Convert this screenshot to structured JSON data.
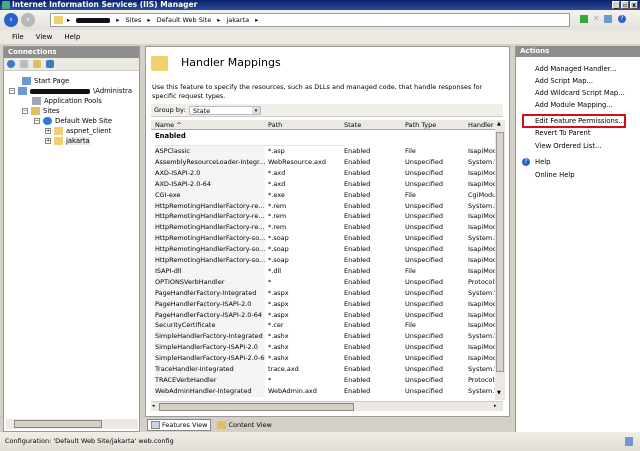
{
  "window": {
    "title": "Internet Information Services (IIS) Manager"
  },
  "address": {
    "crumbs": [
      "Sites",
      "Default Web Site",
      "jakarta"
    ]
  },
  "menu": [
    "File",
    "View",
    "Help"
  ],
  "connections": {
    "title": "Connections",
    "tree": [
      {
        "label": "Start Page"
      },
      {
        "label": "\\Administra"
      },
      {
        "label": "Application Pools"
      },
      {
        "label": "Sites"
      },
      {
        "label": "Default Web Site"
      },
      {
        "label": "aspnet_client"
      },
      {
        "label": "jakarta"
      }
    ]
  },
  "page": {
    "title": "Handler Mappings",
    "description": "Use this feature to specify the resources, such as DLLs and managed code, that handle responses for specific request types.",
    "group_by_label": "Group by:",
    "group_by_value": "State",
    "columns": [
      "Name",
      "Path",
      "State",
      "Path Type",
      "Handler"
    ],
    "group": "Enabled",
    "rows": [
      [
        "ASPClassic",
        "*.asp",
        "Enabled",
        "File",
        "IsapiModule"
      ],
      [
        "AssemblyResourceLoader-Integr...",
        "WebResource.axd",
        "Enabled",
        "Unspecified",
        "System.W"
      ],
      [
        "AXD-ISAPI-2.0",
        "*.axd",
        "Enabled",
        "Unspecified",
        "IsapiModule"
      ],
      [
        "AXD-ISAPI-2.0-64",
        "*.axd",
        "Enabled",
        "Unspecified",
        "IsapiModule"
      ],
      [
        "CGI-exe",
        "*.exe",
        "Enabled",
        "File",
        "CgiModule"
      ],
      [
        "HttpRemotingHandlerFactory-re...",
        "*.rem",
        "Enabled",
        "Unspecified",
        "System.R"
      ],
      [
        "HttpRemotingHandlerFactory-re...",
        "*.rem",
        "Enabled",
        "Unspecified",
        "IsapiModule"
      ],
      [
        "HttpRemotingHandlerFactory-re...",
        "*.rem",
        "Enabled",
        "Unspecified",
        "IsapiModule"
      ],
      [
        "HttpRemotingHandlerFactory-so...",
        "*.soap",
        "Enabled",
        "Unspecified",
        "System.R"
      ],
      [
        "HttpRemotingHandlerFactory-so...",
        "*.soap",
        "Enabled",
        "Unspecified",
        "IsapiModule"
      ],
      [
        "HttpRemotingHandlerFactory-so...",
        "*.soap",
        "Enabled",
        "Unspecified",
        "IsapiModule"
      ],
      [
        "ISAPI-dll",
        "*.dll",
        "Enabled",
        "File",
        "IsapiModule"
      ],
      [
        "OPTIONSVerbHandler",
        "*",
        "Enabled",
        "Unspecified",
        "ProtocolS"
      ],
      [
        "PageHandlerFactory-Integrated",
        "*.aspx",
        "Enabled",
        "Unspecified",
        "System.W"
      ],
      [
        "PageHandlerFactory-ISAPI-2.0",
        "*.aspx",
        "Enabled",
        "Unspecified",
        "IsapiModule"
      ],
      [
        "PageHandlerFactory-ISAPI-2.0-64",
        "*.aspx",
        "Enabled",
        "Unspecified",
        "IsapiModule"
      ],
      [
        "SecurityCertificate",
        "*.cer",
        "Enabled",
        "File",
        "IsapiModule"
      ],
      [
        "SimpleHandlerFactory-Integrated",
        "*.ashx",
        "Enabled",
        "Unspecified",
        "System.W"
      ],
      [
        "SimpleHandlerFactory-ISAPI-2.0",
        "*.ashx",
        "Enabled",
        "Unspecified",
        "IsapiModule"
      ],
      [
        "SimpleHandlerFactory-ISAPI-2.0-64",
        "*.ashx",
        "Enabled",
        "Unspecified",
        "IsapiModule"
      ],
      [
        "TraceHandler-Integrated",
        "trace.axd",
        "Enabled",
        "Unspecified",
        "System.W"
      ],
      [
        "TRACEVerbHandler",
        "*",
        "Enabled",
        "Unspecified",
        "ProtocolS"
      ],
      [
        "WebAdminHandler-Integrated",
        "WebAdmin.axd",
        "Enabled",
        "Unspecified",
        "System.W"
      ]
    ],
    "tabs": [
      "Features View",
      "Content View"
    ]
  },
  "actions": {
    "title": "Actions",
    "items": [
      "Add Managed Handler...",
      "Add Script Map...",
      "Add Wildcard Script Map...",
      "Add Module Mapping...",
      "Edit Feature Permissions...",
      "Revert To Parent",
      "View Ordered List..."
    ],
    "help": [
      "Help",
      "Online Help"
    ],
    "highlight_color": "#d0101a"
  },
  "status": "Configuration: 'Default Web Site/jakarta' web.config"
}
